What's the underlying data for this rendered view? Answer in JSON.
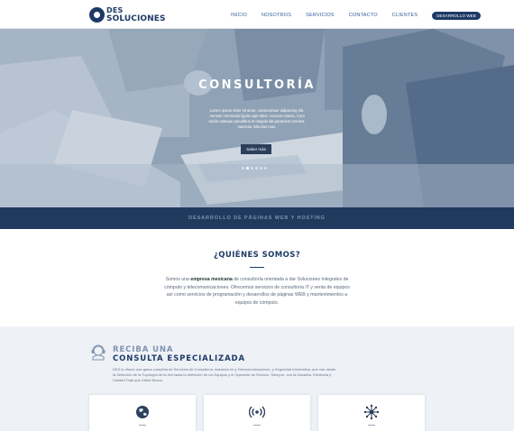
{
  "header": {
    "logo_line1": "DES",
    "logo_line2": "SOLUCIONES",
    "nav": [
      "INICIO",
      "NOSOTROS",
      "SERVICIOS",
      "CONTACTO",
      "CLIENTES"
    ],
    "cta": "DESARROLLO WEB"
  },
  "hero": {
    "title": "CONSULTORÍA",
    "text": "Lorem ipsum dolor sit amet, consectetuer adipiscing elit. Aenean commodo ligula eget dolor. Aenean massa. Cum sociis natoque penatibus et magnis dis parturient montes, nascetur ridiculus mus.",
    "button": "Saber más",
    "slide_count": 6,
    "active_slide": 1,
    "band": "DESARROLLO DE PÁGINAS WEB Y HOSTING"
  },
  "about": {
    "title": "¿QUIÉNES SOMOS?",
    "text_before": "Somos una ",
    "text_bold": "empresa mexicana",
    "text_after": " de consultoría orientada a dar Soluciones Integrales de cómputo y telecomunicaciones. Ofrecemos servicios de consultoría IT y venta de equipos así como servicios de programación y desarrollos de páginas WEB y mantenimientos a equipos de cómputo."
  },
  "consult": {
    "title_line1": "RECIBA UNA",
    "title_line2": "CONSULTA ESPECIALIZADA",
    "text": "DES le ofrece una gama completa de Servicios de Consultoría, Asesoría en y Telecomunicaciones, y Seguridad Informática, que van desde la Selección de la Topología de la red hasta la definición de los Equipos y el Operador de Servicio. Siempre, con la Garantía, Eficiencia y Calidad Total que Usted Busca.",
    "cards": [
      {
        "icon": "globe-icon"
      },
      {
        "icon": "wireless-signal-icon"
      },
      {
        "icon": "network-nodes-icon"
      }
    ]
  },
  "colors": {
    "brand": "#1d3a66",
    "nav_link": "#2d5d9b",
    "band": "#203a5e",
    "section_bg": "#eef1f6"
  }
}
